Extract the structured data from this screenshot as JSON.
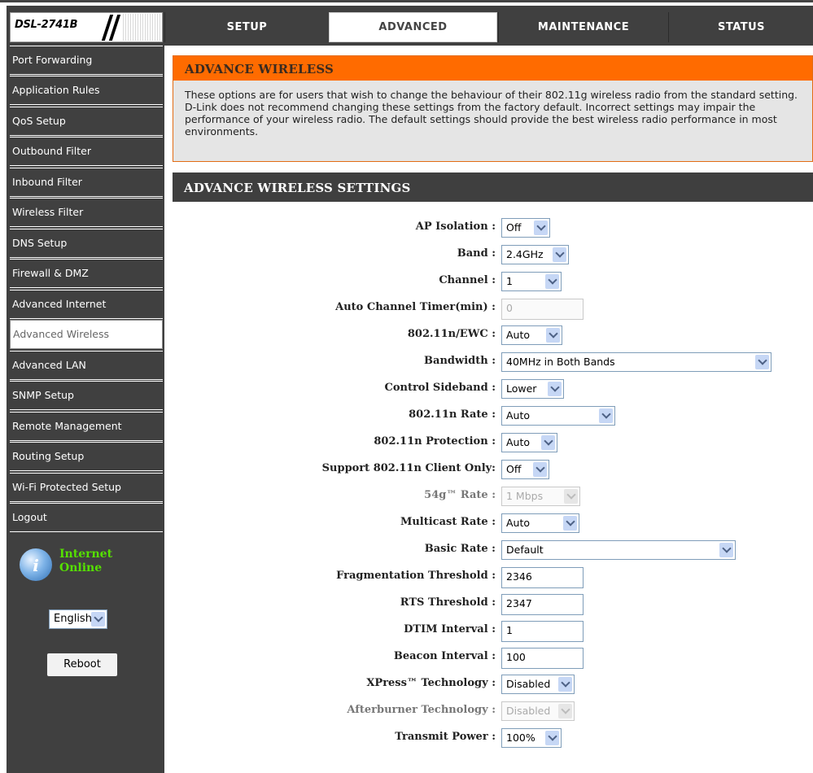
{
  "header": {
    "logo": "DSL-2741B",
    "tabs": [
      {
        "label": "SETUP"
      },
      {
        "label": "ADVANCED"
      },
      {
        "label": "MAINTENANCE"
      },
      {
        "label": "STATUS"
      }
    ]
  },
  "sidebar": {
    "items": [
      {
        "label": "Port Forwarding"
      },
      {
        "label": "Application Rules"
      },
      {
        "label": "QoS Setup"
      },
      {
        "label": "Outbound Filter"
      },
      {
        "label": "Inbound Filter"
      },
      {
        "label": "Wireless Filter"
      },
      {
        "label": "DNS Setup"
      },
      {
        "label": "Firewall & DMZ"
      },
      {
        "label": "Advanced Internet"
      },
      {
        "label": "Advanced Wireless"
      },
      {
        "label": "Advanced LAN"
      },
      {
        "label": "SNMP Setup"
      },
      {
        "label": "Remote Management"
      },
      {
        "label": "Routing Setup"
      },
      {
        "label": "Wi-Fi Protected Setup"
      },
      {
        "label": "Logout"
      }
    ],
    "status_line1": "Internet",
    "status_line2": "Online",
    "language": "English",
    "reboot_label": "Reboot"
  },
  "advance_wireless": {
    "title": "ADVANCE WIRELESS",
    "description": "These options are for users that wish to change the behaviour of their 802.11g wireless radio from the standard setting. D-Link does not recommend changing these settings from the factory default. Incorrect settings may impair the performance of your wireless radio. The default settings should provide the best wireless radio performance in most environments."
  },
  "settings": {
    "title": "ADVANCE WIRELESS SETTINGS",
    "fields": [
      {
        "label": "AP Isolation :",
        "value": "Off"
      },
      {
        "label": "Band :",
        "value": "2.4GHz"
      },
      {
        "label": "Channel :",
        "value": "1"
      },
      {
        "label": "Auto Channel Timer(min) :",
        "value": "0"
      },
      {
        "label": "802.11n/EWC :",
        "value": "Auto"
      },
      {
        "label": "Bandwidth :",
        "value": "40MHz in Both Bands"
      },
      {
        "label": "Control Sideband :",
        "value": "Lower"
      },
      {
        "label": "802.11n Rate :",
        "value": "Auto"
      },
      {
        "label": "802.11n Protection :",
        "value": "Auto"
      },
      {
        "label": "Support 802.11n Client Only:",
        "value": "Off"
      },
      {
        "label": "54g™ Rate :",
        "value": "1 Mbps"
      },
      {
        "label": "Multicast Rate :",
        "value": "Auto"
      },
      {
        "label": "Basic Rate :",
        "value": "Default"
      },
      {
        "label": "Fragmentation Threshold :",
        "value": "2346"
      },
      {
        "label": "RTS Threshold :",
        "value": "2347"
      },
      {
        "label": "DTIM Interval :",
        "value": "1"
      },
      {
        "label": "Beacon Interval :",
        "value": "100"
      },
      {
        "label": "XPress™ Technology :",
        "value": "Disabled"
      },
      {
        "label": "Afterburner Technology :",
        "value": "Disabled"
      },
      {
        "label": "Transmit Power :",
        "value": "100%"
      }
    ]
  },
  "colors": {
    "accent": "#ff6b00",
    "nav_bg": "#404040",
    "status_online": "#55e000"
  }
}
